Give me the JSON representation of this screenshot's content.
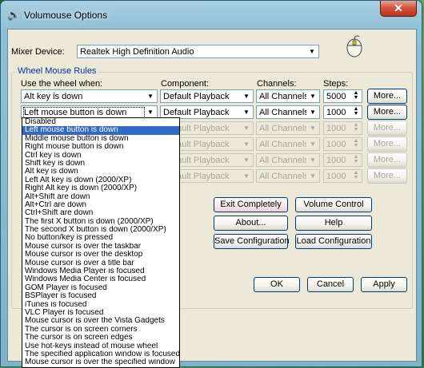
{
  "window": {
    "title": "Volumouse Options",
    "close_symbol": "✕"
  },
  "mixer": {
    "label": "Mixer Device:",
    "value": "Realtek High Definition Audio"
  },
  "group": {
    "title": "Wheel Mouse Rules"
  },
  "headers": {
    "use": "Use the wheel when:",
    "component": "Component:",
    "channels": "Channels:",
    "steps": "Steps:"
  },
  "rows": [
    {
      "use": "Alt key is down",
      "component": "Default Playback",
      "channels": "All Channels",
      "steps": "5000",
      "more": "More..."
    },
    {
      "use": "Left mouse button is down",
      "component": "Default Playback",
      "channels": "All Channels",
      "steps": "1000",
      "more": "More..."
    },
    {
      "use": "",
      "component": "Default Playback",
      "channels": "All Channels",
      "steps": "1000",
      "more": "More..."
    },
    {
      "use": "",
      "component": "Default Playback",
      "channels": "All Channels",
      "steps": "1000",
      "more": "More..."
    },
    {
      "use": "",
      "component": "Default Playback",
      "channels": "All Channels",
      "steps": "1000",
      "more": "More..."
    },
    {
      "use": "",
      "component": "Default Playback",
      "channels": "All Channels",
      "steps": "1000",
      "more": "More..."
    }
  ],
  "buttons": {
    "exit": "Exit Completely",
    "volume": "Volume Control",
    "about": "About...",
    "help": "Help",
    "save": "Save Configuration",
    "load": "Load Configuration",
    "ok": "OK",
    "cancel": "Cancel",
    "apply": "Apply"
  },
  "dropdown_options": [
    "Disabled",
    "Left mouse button is down",
    "Middle mouse button is down",
    "Right mouse button is down",
    "Ctrl key is down",
    "Shift key is down",
    "Alt key is down",
    "Left Alt key is down  (2000/XP)",
    "Right Alt key is down  (2000/XP)",
    "Alt+Shift are down",
    "Alt+Ctrl are down",
    "Ctrl+Shift are down",
    "The first X button is down  (2000/XP)",
    "The second X button is down  (2000/XP)",
    "No button/key is pressed",
    "Mouse cursor is over the taskbar",
    "Mouse cursor is over the desktop",
    "Mouse cursor is over a title bar",
    "Windows Media Player is focused",
    "Windows Media Center is focused",
    "GOM Player is focused",
    "BSPlayer is focused",
    "iTunes is focused",
    "VLC Player is focused",
    "Mouse cursor is over the Vista Gadgets",
    "The cursor is on screen corners",
    "The cursor is on screen edges",
    "Use hot-keys instead of mouse wheel",
    "The specified application window is focused",
    "Mouse cursor is over the specified window"
  ],
  "dropdown_selected_index": 1,
  "icons": {
    "dropdown_arrow": "▼",
    "spin_up": "▲",
    "spin_down": "▼"
  },
  "colors": {
    "selection": "#316ac5",
    "face": "#ece9d8"
  }
}
